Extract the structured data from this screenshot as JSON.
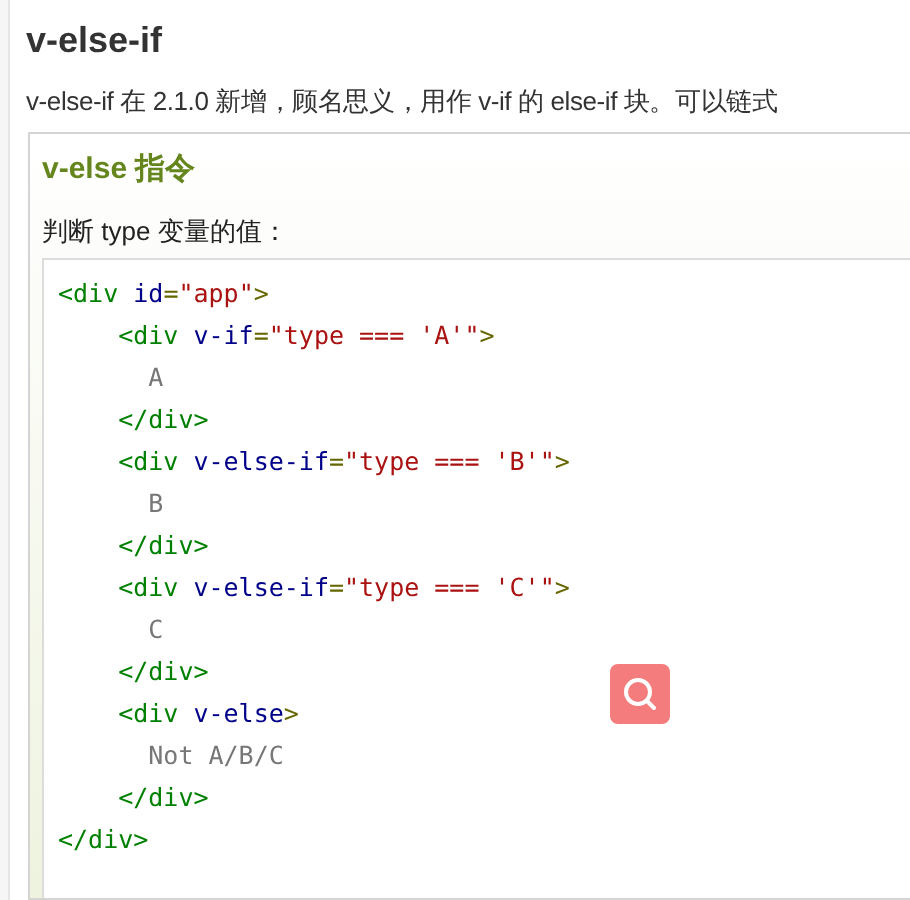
{
  "heading": "v-else-if",
  "intro": "v-else-if 在 2.1.0 新增，顾名思义，用作 v-if 的 else-if 块。可以链式",
  "example": {
    "title": "v-else 指令",
    "caption": "判断 type 变量的值：",
    "code": {
      "open": [
        {
          "kind": "tag",
          "text": "<div"
        },
        {
          "kind": "attr",
          "text": "id"
        },
        {
          "kind": "punct",
          "text": "="
        },
        {
          "kind": "value",
          "text": "\"app\""
        },
        {
          "kind": "punct",
          "text": ">"
        }
      ],
      "children": [
        {
          "open": [
            {
              "kind": "tag",
              "text": "<div"
            },
            {
              "kind": "attr",
              "text": "v-if"
            },
            {
              "kind": "punct",
              "text": "="
            },
            {
              "kind": "value",
              "text": "\"type === 'A'\""
            },
            {
              "kind": "punct",
              "text": ">"
            }
          ],
          "children": [
            {
              "text": "A"
            }
          ],
          "close": [
            {
              "kind": "tag",
              "text": "</div>"
            }
          ]
        },
        {
          "open": [
            {
              "kind": "tag",
              "text": "<div"
            },
            {
              "kind": "attr",
              "text": "v-else-if"
            },
            {
              "kind": "punct",
              "text": "="
            },
            {
              "kind": "value",
              "text": "\"type === 'B'\""
            },
            {
              "kind": "punct",
              "text": ">"
            }
          ],
          "children": [
            {
              "text": "B"
            }
          ],
          "close": [
            {
              "kind": "tag",
              "text": "</div>"
            }
          ]
        },
        {
          "open": [
            {
              "kind": "tag",
              "text": "<div"
            },
            {
              "kind": "attr",
              "text": "v-else-if"
            },
            {
              "kind": "punct",
              "text": "="
            },
            {
              "kind": "value",
              "text": "\"type === 'C'\""
            },
            {
              "kind": "punct",
              "text": ">"
            }
          ],
          "children": [
            {
              "text": "C"
            }
          ],
          "close": [
            {
              "kind": "tag",
              "text": "</div>"
            }
          ]
        },
        {
          "open": [
            {
              "kind": "tag",
              "text": "<div"
            },
            {
              "kind": "attr",
              "text": "v-else"
            },
            {
              "kind": "punct",
              "text": ">"
            }
          ],
          "children": [
            {
              "text": "Not A/B/C"
            }
          ],
          "close": [
            {
              "kind": "tag",
              "text": "</div>"
            }
          ]
        }
      ],
      "close": [
        {
          "kind": "tag",
          "text": "</div>"
        }
      ]
    }
  }
}
